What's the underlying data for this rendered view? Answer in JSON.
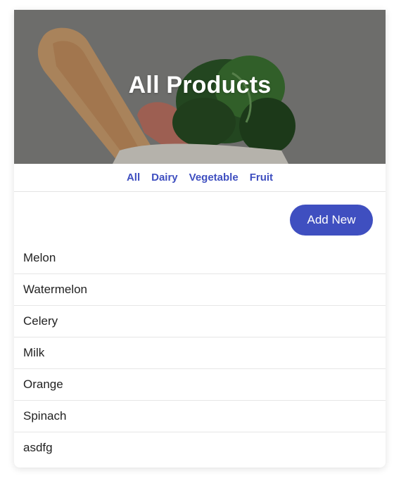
{
  "hero": {
    "title": "All Products"
  },
  "filters": [
    "All",
    "Dairy",
    "Vegetable",
    "Fruit"
  ],
  "toolbar": {
    "add_label": "Add New"
  },
  "products": [
    "Melon",
    "Watermelon",
    "Celery",
    "Milk",
    "Orange",
    "Spinach",
    "asdfg"
  ],
  "colors": {
    "accent": "#3f4fc0",
    "text": "#222222",
    "divider": "#e6e6e6"
  }
}
